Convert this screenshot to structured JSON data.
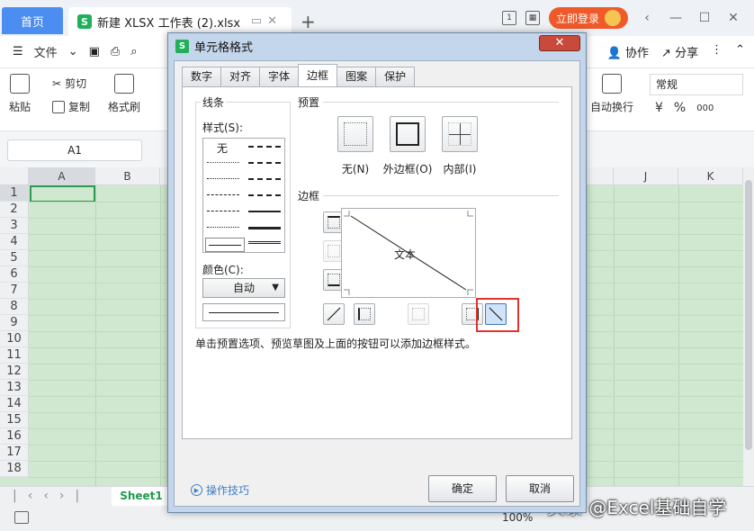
{
  "titlebar": {
    "home_tab": "首页",
    "doc_badge": "S",
    "doc_tab": "新建 XLSX 工作表 (2).xlsx",
    "login_button": "立即登录"
  },
  "menubar": {
    "file": "文件",
    "collab": "协作",
    "share": "分享"
  },
  "ribbon": {
    "paste": "粘贴",
    "cut": "剪切",
    "copy": "复制",
    "format_painter": "格式刷",
    "wrap_text": "自动换行",
    "number_format": "常规",
    "currency_symbol": "¥",
    "percent_symbol": "%",
    "thousands_symbol": "000"
  },
  "formula": {
    "namebox": "A1"
  },
  "sheet": {
    "columns": [
      "A",
      "B",
      "J",
      "K"
    ],
    "rows": [
      "1",
      "2",
      "3",
      "4",
      "5",
      "6",
      "7",
      "8",
      "9",
      "10",
      "11",
      "12",
      "13",
      "14",
      "15",
      "16",
      "17",
      "18"
    ],
    "tab": "Sheet1"
  },
  "status": {
    "zoom": "100%"
  },
  "watermark": "头条 @Excel基础自学",
  "dialog": {
    "title": "单元格格式",
    "close": "✕",
    "tabs": [
      "数字",
      "对齐",
      "字体",
      "边框",
      "图案",
      "保护"
    ],
    "active_tab": "边框",
    "line_group": "线条",
    "style_label": "样式(S):",
    "style_none": "无",
    "color_label": "颜色(C):",
    "color_value": "自动",
    "preset_group": "预置",
    "presets": [
      "无(N)",
      "外边框(O)",
      "内部(I)"
    ],
    "border_group": "边框",
    "preview_text": "文本",
    "hint": "单击预置选项、预览草图及上面的按钮可以添加边框样式。",
    "tips": "操作技巧",
    "ok": "确定",
    "cancel": "取消"
  }
}
